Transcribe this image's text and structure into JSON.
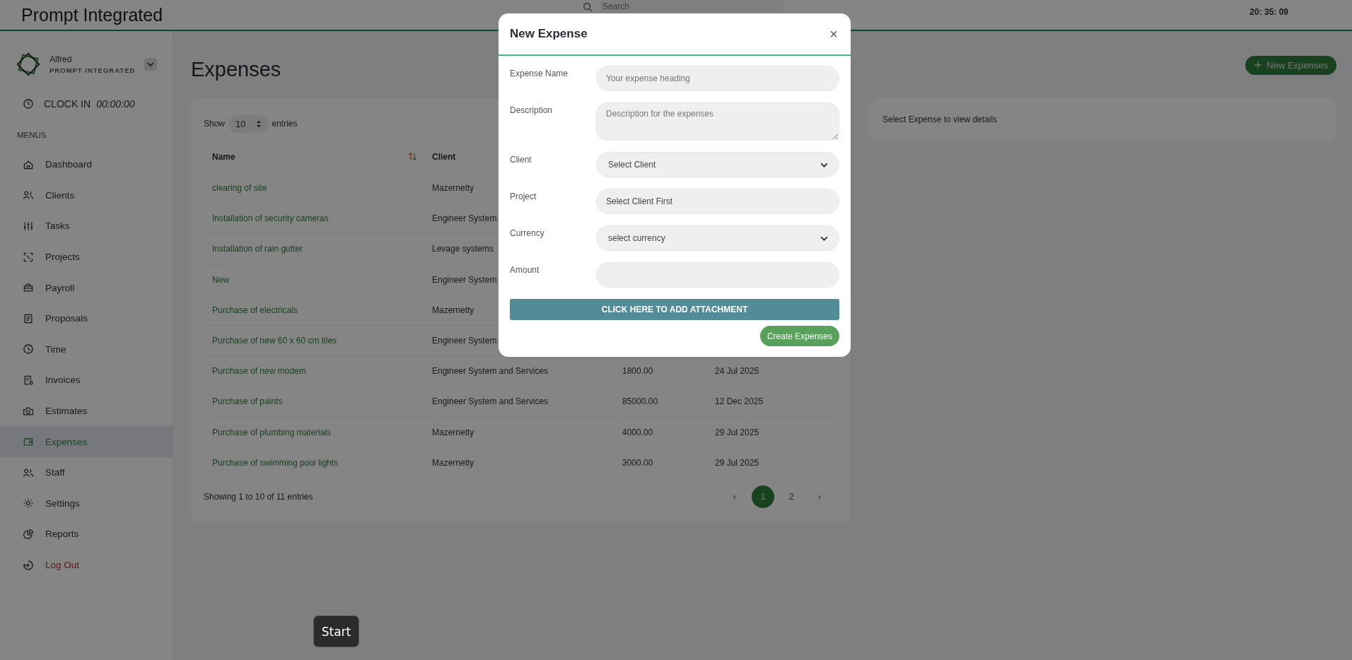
{
  "app": {
    "title": "Prompt Integrated",
    "search_placeholder": "Search",
    "clock": "20: 35: 09"
  },
  "sidebar": {
    "user": {
      "name": "Alfred",
      "company": "PROMPT INTEGRATED"
    },
    "clock_in": {
      "label": "CLOCK IN",
      "time": "00:00:00"
    },
    "section": "MENUS",
    "items": [
      {
        "label": "Dashboard",
        "selected": false,
        "kind": "link"
      },
      {
        "label": "Clients",
        "selected": false,
        "kind": "link"
      },
      {
        "label": "Tasks",
        "selected": false,
        "kind": "link"
      },
      {
        "label": "Projects",
        "selected": false,
        "kind": "link"
      },
      {
        "label": "Payroll",
        "selected": false,
        "kind": "link"
      },
      {
        "label": "Proposals",
        "selected": false,
        "kind": "link"
      },
      {
        "label": "Time",
        "selected": false,
        "kind": "link"
      },
      {
        "label": "Invoices",
        "selected": false,
        "kind": "link"
      },
      {
        "label": "Estimates",
        "selected": false,
        "kind": "link"
      },
      {
        "label": "Expenses",
        "selected": true,
        "kind": "link"
      },
      {
        "label": "Staff",
        "selected": false,
        "kind": "link"
      },
      {
        "label": "Settings",
        "selected": false,
        "kind": "link"
      },
      {
        "label": "Reports",
        "selected": false,
        "kind": "link"
      },
      {
        "label": "Log Out",
        "selected": false,
        "kind": "danger"
      }
    ]
  },
  "page": {
    "title": "Expenses",
    "new_button": "New Expenses",
    "table": {
      "show_label": "Show",
      "page_size": "10",
      "entries_label": "entries",
      "columns": [
        "Name",
        "Client"
      ],
      "rows": [
        {
          "name": "clearing of site",
          "client": "Mazernetty"
        },
        {
          "name": "Installation of security cameras",
          "client": "Engineer System"
        },
        {
          "name": "Installation of rain gutter",
          "client": "Levage systems"
        },
        {
          "name": "New",
          "client": "Engineer System"
        },
        {
          "name": "Purchase of electricals",
          "client": "Mazernetty"
        },
        {
          "name": "Purchase of new 60 x 60 cm tiles",
          "client": "Engineer System"
        },
        {
          "name": "Purchase of new modem",
          "client": "Engineer System and Services",
          "amount": "1800.00",
          "date": "24 Jul 2025"
        },
        {
          "name": "Purchase of paints",
          "client": "Engineer System and Services",
          "amount": "85000.00",
          "date": "12 Dec 2025"
        },
        {
          "name": "Purchase of plumbing materials",
          "client": "Mazernetty",
          "amount": "4000.00",
          "date": "29 Jul 2025"
        },
        {
          "name": "Purchase of swimming pool lights",
          "client": "Mazernetty",
          "amount": "3000.00",
          "date": "29 Jul 2025"
        }
      ],
      "info": "Showing 1 to 10 of 11 entries",
      "pagination": {
        "prev": "‹",
        "pages": [
          {
            "label": "1",
            "selected": true
          },
          {
            "label": "2",
            "selected": false
          }
        ],
        "next": "›"
      }
    },
    "details": {
      "text": "Select Expense to view details"
    }
  },
  "modal": {
    "title": "New Expense",
    "close": "×",
    "fields": [
      {
        "label": "Expense Name",
        "kind": "input",
        "placeholder": "Your expense heading"
      },
      {
        "label": "Description",
        "kind": "textarea",
        "placeholder": "Description for the expenses"
      },
      {
        "label": "Client",
        "kind": "select",
        "value": "Select Client"
      },
      {
        "label": "Project",
        "kind": "input",
        "value": "Select Client First"
      },
      {
        "label": "Currency",
        "kind": "select",
        "value": "select currency"
      },
      {
        "label": "Amount",
        "kind": "input"
      }
    ],
    "attach_button": "CLICK HERE TO ADD ATTACHMENT",
    "submit_button": "Create Expenses"
  },
  "start_button": "Start"
}
